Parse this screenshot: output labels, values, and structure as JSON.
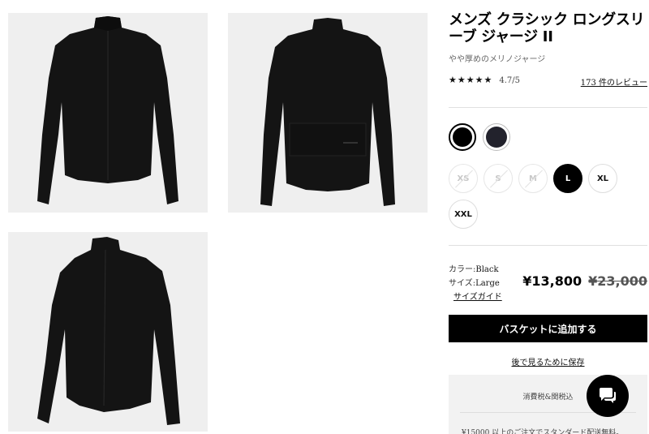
{
  "product": {
    "title": "メンズ クラシック ロングスリーブ ジャージ II",
    "subtitle": "やや厚めのメリノジャージ",
    "rating_value": "4.7/5",
    "rating_stars": 4.5,
    "reviews_link": "173 件のレビュー"
  },
  "images": [
    {
      "icon": "jersey-front-photo"
    },
    {
      "icon": "jersey-back-photo"
    },
    {
      "icon": "jersey-angle-photo"
    }
  ],
  "colors": [
    {
      "name": "Black",
      "hex": "#000000",
      "selected": true
    },
    {
      "name": "Navy",
      "hex": "#22222c",
      "selected": false
    }
  ],
  "sizes": [
    {
      "label": "XS",
      "available": false,
      "selected": false
    },
    {
      "label": "S",
      "available": false,
      "selected": false
    },
    {
      "label": "M",
      "available": false,
      "selected": false
    },
    {
      "label": "L",
      "available": true,
      "selected": true
    },
    {
      "label": "XL",
      "available": true,
      "selected": false
    },
    {
      "label": "XXL",
      "available": true,
      "selected": false
    }
  ],
  "selection": {
    "color_label": "カラー:",
    "color_value": "Black",
    "size_label": "サイズ:",
    "size_value": "Large",
    "size_guide": "サイズガイド"
  },
  "price": {
    "current": "¥13,800",
    "original": "¥23,000"
  },
  "actions": {
    "add_to_basket": "バスケットに追加する",
    "save_for_later": "後で見るために保存"
  },
  "notice": {
    "tax": "消費税&関税込",
    "shipping": "¥15000 以上のご注文でスタンダード配送無料。"
  },
  "chat": {
    "icon": "chat-bubble-icon"
  },
  "theme": {
    "accent": "#000000",
    "panel_bg": "#f2f2f2"
  }
}
